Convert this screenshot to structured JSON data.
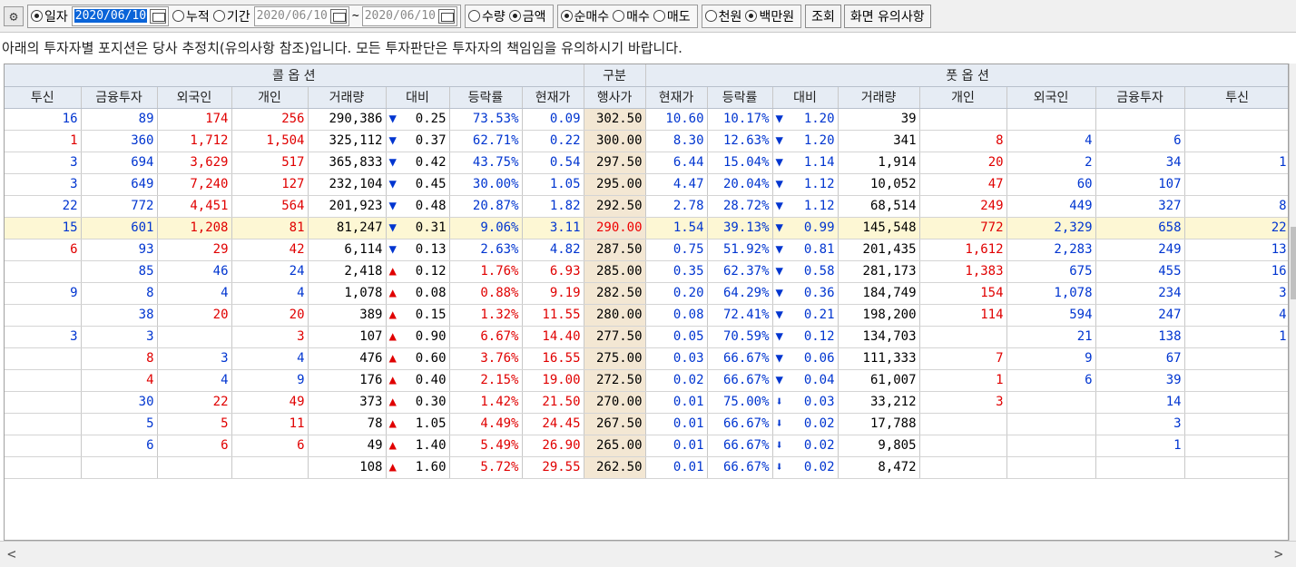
{
  "toolbar": {
    "date_mode": [
      "일자",
      "누적",
      "기간"
    ],
    "date_selected": "2020/06/10",
    "period_from": "2020/06/10",
    "period_to": "2020/06/10",
    "tilde": "~",
    "unit_type": [
      "수량",
      "금액"
    ],
    "trade_type": [
      "순매수",
      "매수",
      "매도"
    ],
    "currency_unit": [
      "천원",
      "백만원"
    ],
    "query_button": "조회",
    "notice_button": "화면 유의사항"
  },
  "notice": "아래의 투자자별 포지션은 당사 추정치(유의사항 참조)입니다. 모든 투자판단은 투자자의 책임임을 유의하시기 바랍니다.",
  "groups": {
    "call": "콜 옵 션",
    "mid": "구분",
    "put": "풋 옵 션"
  },
  "columns": [
    "투신",
    "금융투자",
    "외국인",
    "개인",
    "거래량",
    "대비",
    "등락률",
    "현재가",
    "행사가",
    "현재가",
    "등락률",
    "대비",
    "거래량",
    "개인",
    "외국인",
    "금융투자",
    "투신"
  ],
  "rows": [
    {
      "c": [
        "16",
        "89",
        "174",
        "256",
        "290,386",
        "0.25",
        "73.53%",
        "0.09"
      ],
      "cdir": "down",
      "k": "302.50",
      "p": [
        "10.60",
        "10.17%",
        "1.20",
        "39",
        "",
        "",
        "",
        ""
      ],
      "pdir": "down"
    },
    {
      "c": [
        "1",
        "360",
        "1,712",
        "1,504",
        "325,112",
        "0.37",
        "62.71%",
        "0.22"
      ],
      "cdir": "down",
      "k": "300.00",
      "p": [
        "8.30",
        "12.63%",
        "1.20",
        "341",
        "8",
        "4",
        "6",
        ""
      ],
      "pdir": "down"
    },
    {
      "c": [
        "3",
        "694",
        "3,629",
        "517",
        "365,833",
        "0.42",
        "43.75%",
        "0.54"
      ],
      "cdir": "down",
      "k": "297.50",
      "p": [
        "6.44",
        "15.04%",
        "1.14",
        "1,914",
        "20",
        "2",
        "34",
        "1"
      ],
      "pdir": "down"
    },
    {
      "c": [
        "3",
        "649",
        "7,240",
        "127",
        "232,104",
        "0.45",
        "30.00%",
        "1.05"
      ],
      "cdir": "down",
      "k": "295.00",
      "p": [
        "4.47",
        "20.04%",
        "1.12",
        "10,052",
        "47",
        "60",
        "107",
        ""
      ],
      "pdir": "down"
    },
    {
      "c": [
        "22",
        "772",
        "4,451",
        "564",
        "201,923",
        "0.48",
        "20.87%",
        "1.82"
      ],
      "cdir": "down",
      "k": "292.50",
      "p": [
        "2.78",
        "28.72%",
        "1.12",
        "68,514",
        "249",
        "449",
        "327",
        "8"
      ],
      "pdir": "down"
    },
    {
      "c": [
        "15",
        "601",
        "1,208",
        "81",
        "81,247",
        "0.31",
        "9.06%",
        "3.11"
      ],
      "cdir": "down",
      "k": "290.00",
      "p": [
        "1.54",
        "39.13%",
        "0.99",
        "145,548",
        "772",
        "2,329",
        "658",
        "22"
      ],
      "pdir": "down",
      "hl": true
    },
    {
      "c": [
        "6",
        "93",
        "29",
        "42",
        "6,114",
        "0.13",
        "2.63%",
        "4.82"
      ],
      "cdir": "down",
      "k": "287.50",
      "p": [
        "0.75",
        "51.92%",
        "0.81",
        "201,435",
        "1,612",
        "2,283",
        "249",
        "13"
      ],
      "pdir": "down"
    },
    {
      "c": [
        "",
        "85",
        "46",
        "24",
        "2,418",
        "0.12",
        "1.76%",
        "6.93"
      ],
      "cdir": "up",
      "k": "285.00",
      "p": [
        "0.35",
        "62.37%",
        "0.58",
        "281,173",
        "1,383",
        "675",
        "455",
        "16"
      ],
      "pdir": "down"
    },
    {
      "c": [
        "9",
        "8",
        "4",
        "4",
        "1,078",
        "0.08",
        "0.88%",
        "9.19"
      ],
      "cdir": "up",
      "k": "282.50",
      "p": [
        "0.20",
        "64.29%",
        "0.36",
        "184,749",
        "154",
        "1,078",
        "234",
        "3"
      ],
      "pdir": "down"
    },
    {
      "c": [
        "",
        "38",
        "20",
        "20",
        "389",
        "0.15",
        "1.32%",
        "11.55"
      ],
      "cdir": "up",
      "k": "280.00",
      "p": [
        "0.08",
        "72.41%",
        "0.21",
        "198,200",
        "114",
        "594",
        "247",
        "4"
      ],
      "pdir": "down"
    },
    {
      "c": [
        "3",
        "3",
        "",
        "3",
        "107",
        "0.90",
        "6.67%",
        "14.40"
      ],
      "cdir": "up",
      "k": "277.50",
      "p": [
        "0.05",
        "70.59%",
        "0.12",
        "134,703",
        "",
        "21",
        "138",
        "1"
      ],
      "pdir": "down"
    },
    {
      "c": [
        "",
        "8",
        "3",
        "4",
        "476",
        "0.60",
        "3.76%",
        "16.55"
      ],
      "cdir": "up",
      "k": "275.00",
      "p": [
        "0.03",
        "66.67%",
        "0.06",
        "111,333",
        "7",
        "9",
        "67",
        ""
      ],
      "pdir": "down"
    },
    {
      "c": [
        "",
        "4",
        "4",
        "9",
        "176",
        "0.40",
        "2.15%",
        "19.00"
      ],
      "cdir": "up",
      "k": "272.50",
      "p": [
        "0.02",
        "66.67%",
        "0.04",
        "61,007",
        "1",
        "6",
        "39",
        ""
      ],
      "pdir": "down"
    },
    {
      "c": [
        "",
        "30",
        "22",
        "49",
        "373",
        "0.30",
        "1.42%",
        "21.50"
      ],
      "cdir": "up",
      "k": "270.00",
      "p": [
        "0.01",
        "75.00%",
        "0.03",
        "33,212",
        "3",
        "",
        "14",
        ""
      ],
      "pdir": "limitdown"
    },
    {
      "c": [
        "",
        "5",
        "5",
        "11",
        "78",
        "1.05",
        "4.49%",
        "24.45"
      ],
      "cdir": "up",
      "k": "267.50",
      "p": [
        "0.01",
        "66.67%",
        "0.02",
        "17,788",
        "",
        "",
        "3",
        ""
      ],
      "pdir": "limitdown"
    },
    {
      "c": [
        "",
        "6",
        "6",
        "6",
        "49",
        "1.40",
        "5.49%",
        "26.90"
      ],
      "cdir": "up",
      "k": "265.00",
      "p": [
        "0.01",
        "66.67%",
        "0.02",
        "9,805",
        "",
        "",
        "1",
        ""
      ],
      "pdir": "limitdown"
    },
    {
      "c": [
        "",
        "",
        "",
        "",
        "108",
        "1.60",
        "5.72%",
        "29.55"
      ],
      "cdir": "up",
      "k": "262.50",
      "p": [
        "0.01",
        "66.67%",
        "0.02",
        "8,472",
        "",
        "",
        "",
        ""
      ],
      "pdir": "limitdown"
    }
  ],
  "colors": {
    "up": "#e00000",
    "down": "#0035d0",
    "strike_bg": "#f3e7d3",
    "highlight_bg": "#fdf7d4",
    "header_bg": "#e6ecf4"
  }
}
